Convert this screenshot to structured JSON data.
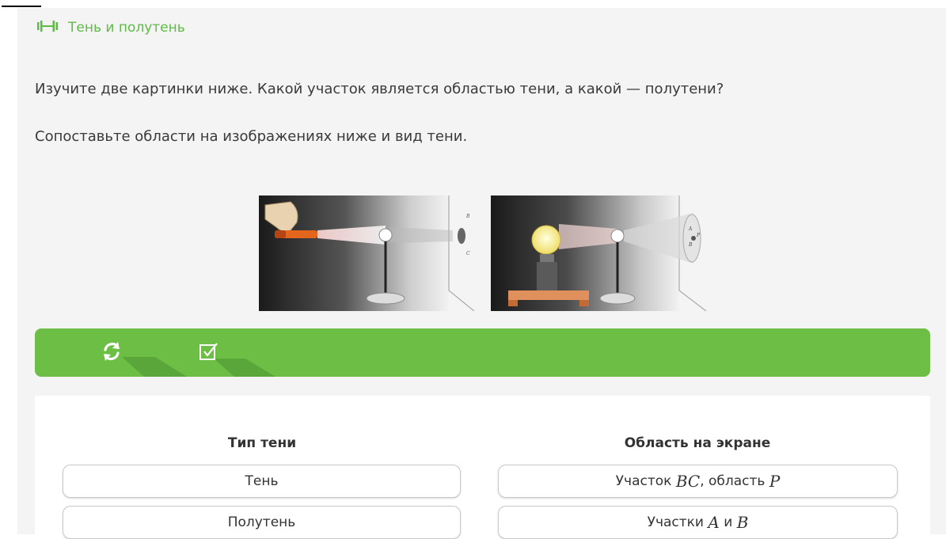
{
  "task": {
    "title": "Тень и полутень",
    "question": "Изучите две картинки ниже. Какой участок является областью тени, а какой — полутени?",
    "instruction": "Сопоставьте области на изображениях ниже и вид тени."
  },
  "toolbar": {
    "refresh_icon": "refresh-icon",
    "check_icon": "checkbox-check-icon"
  },
  "matching": {
    "left_header": "Тип тени",
    "right_header": "Область на экране",
    "left_items": [
      "Тень",
      "Полутень"
    ],
    "right_items": [
      {
        "prefix": "Участок ",
        "math1": "BC",
        "mid": ", область ",
        "math2": "P"
      },
      {
        "prefix": "Участки ",
        "math1": "A",
        "mid": " и ",
        "math2": "B"
      }
    ]
  },
  "illustrations": {
    "image1_labels": [
      "B",
      "C"
    ],
    "image2_labels": [
      "A",
      "P",
      "B"
    ]
  },
  "colors": {
    "accent_green": "#6cbe45",
    "title_green": "#5fba46",
    "text": "#3a3a3a"
  }
}
